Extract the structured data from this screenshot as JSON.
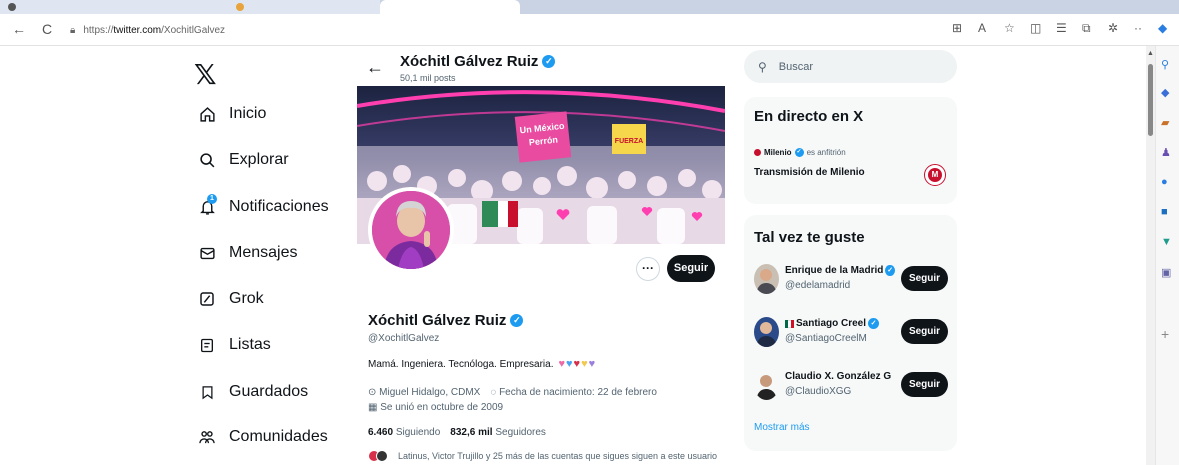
{
  "browser": {
    "url_prefix": "https://",
    "url_domain": "twitter.com",
    "url_path": "/XochitlGalvez",
    "back_icon": "←",
    "refresh_icon": "C",
    "toolbar_icons": [
      "split-screen-icon",
      "read-aloud-icon",
      "favorite-star-icon",
      "split-window-icon",
      "favorites-icon",
      "collections-icon",
      "extensions-icon",
      "copilot-icon"
    ]
  },
  "nav": {
    "logo": "𝕏",
    "items": [
      {
        "label": "Inicio",
        "icon": "home-icon"
      },
      {
        "label": "Explorar",
        "icon": "search-icon"
      },
      {
        "label": "Notificaciones",
        "icon": "bell-icon",
        "badge": "1"
      },
      {
        "label": "Mensajes",
        "icon": "envelope-icon"
      },
      {
        "label": "Grok",
        "icon": "grok-icon"
      },
      {
        "label": "Listas",
        "icon": "list-icon"
      },
      {
        "label": "Guardados",
        "icon": "bookmark-icon"
      },
      {
        "label": "Comunidades",
        "icon": "people-icon"
      }
    ]
  },
  "header": {
    "name": "Xóchitl Gálvez Ruiz",
    "posts": "50,1 mil posts",
    "back": "←"
  },
  "profile": {
    "name": "Xóchitl Gálvez Ruiz",
    "handle": "@XochitlGalvez",
    "bio": "Mamá. Ingeniera. Tecnóloga. Empresaria.",
    "bio_hearts": [
      "#ec6aa6",
      "#4aa3f0",
      "#d6304a",
      "#f2c94c",
      "#9b7fdc"
    ],
    "location": "Miguel Hidalgo, CDMX",
    "birthday": "Fecha de nacimiento: 22 de febrero",
    "joined": "Se unió en octubre de 2009",
    "following_count": "6.460",
    "following_label": "Siguiendo",
    "followers_count": "832,6 mil",
    "followers_label": "Seguidores",
    "followed_by": "Latinus, Victor Trujillo y 25 más de las cuentas que sigues siguen a este usuario",
    "follow_label": "Seguir",
    "more_label": "···",
    "banner_signs": [
      "Un México Perrón",
      "FUERZA"
    ]
  },
  "search": {
    "placeholder": "Buscar"
  },
  "live": {
    "title": "En directo en X",
    "host": "Milenio",
    "host_suffix": "es anfitrión",
    "stream": "Transmisión de Milenio",
    "logo_letter": "M"
  },
  "suggestions": {
    "title": "Tal vez te guste",
    "items": [
      {
        "name": "Enrique de la Madrid",
        "handle": "@edelamadrid",
        "flag": false
      },
      {
        "name": "Santiago Creel",
        "handle": "@SantiagoCreelM",
        "flag": true
      },
      {
        "name": "Claudio X. González G",
        "handle": "@ClaudioXGG",
        "flag": false
      }
    ],
    "follow_label": "Seguir",
    "show_more": "Mostrar más"
  },
  "colors": {
    "accent": "#1d9bf0",
    "dark": "#0f1419",
    "muted": "#536471"
  }
}
